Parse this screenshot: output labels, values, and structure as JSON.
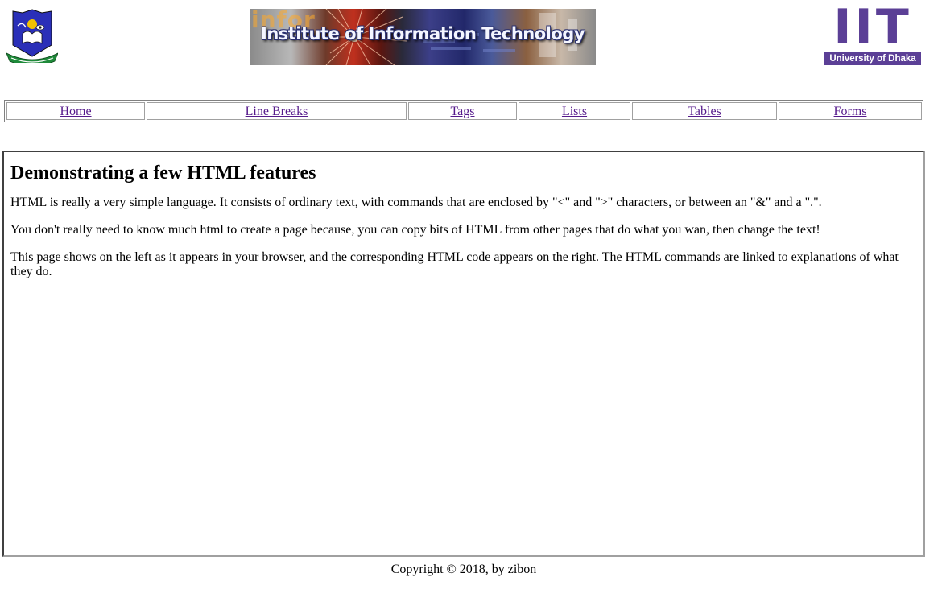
{
  "header": {
    "left_logo": "university-of-dhaka-logo",
    "banner_watermark": "infor",
    "banner_title": "Institute of Information Technology",
    "right_logo_letters": "IIT",
    "right_logo_subtitle": "University of Dhaka"
  },
  "nav": {
    "items": [
      {
        "label": "Home"
      },
      {
        "label": "Line Breaks"
      },
      {
        "label": "Tags"
      },
      {
        "label": "Lists"
      },
      {
        "label": "Tables"
      },
      {
        "label": "Forms"
      }
    ]
  },
  "main": {
    "heading": "Demonstrating a few HTML features",
    "paragraphs": [
      "HTML is really a very simple language. It consists of ordinary text, with commands that are enclosed by \"<\" and \">\" characters, or between an \"&\" and a \".\".",
      "You don't really need to know much html to create a page because, you can copy bits of HTML from other pages that do what you wan, then change the text!",
      "This page shows on the left as it appears in your browser, and the corresponding HTML code appears on the right. The HTML commands are linked to explanations of what they do."
    ]
  },
  "footer": {
    "text": "Copyright © 2018, by zibon"
  },
  "colors": {
    "link_visited": "#551a8b",
    "iit_purple": "#5b3f96",
    "du_logo_blue": "#1e2aa8"
  }
}
